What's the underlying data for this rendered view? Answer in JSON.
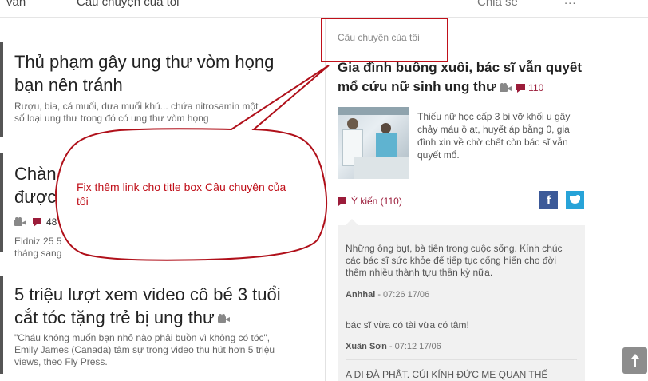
{
  "topnav": {
    "left_text": "văn",
    "tab_label": "Câu chuyện của tôi",
    "right_text": "Chia sẻ",
    "more_text": "..."
  },
  "articles": [
    {
      "title": "Thủ phạm gây ung thư vòm họng bạn nên tránh",
      "desc": "Rượu, bia, cá muối, dưa muối khú... chứa nitrosamin một số loại ung thư trong đó có ung thư vòm họng"
    },
    {
      "title": "Chàn được",
      "comment_count": "48",
      "byline": "Eldniz 25 5 tháng sang"
    },
    {
      "title": "5 triệu lượt xem video cô bé 3 tuổi cắt tóc tặng trẻ bị ung thư",
      "desc": "\"Cháu không muốn bạn nhỏ nào phải buồn vì không có tóc\", Emily James (Canada) tâm sự trong video thu hút hơn 5 triệu views, theo Fly Press."
    }
  ],
  "sidebar": {
    "box_title": "Câu chuyện của tôi",
    "main_title": "Gia đình buông xuôi, bác sĩ vẫn quyết mổ cứu nữ sinh ung thư",
    "main_comment_count": "110",
    "summary": "Thiếu nữ học cấp 3 bị vỡ khối u gây chảy máu ồ ạt, huyết áp bằng 0, gia đình xin về chờ chết còn bác sĩ vẫn quyết mổ.",
    "opinion_label": "Ý kiến (110)",
    "facebook_letter": "f",
    "comments": [
      {
        "text": "Những ông bụt, bà tiên trong cuộc sống. Kính chúc các bác sĩ sức khỏe để tiếp tục cống hiến cho đời thêm nhiều thành tựu thần kỳ nữa.",
        "author": "Anhhai",
        "time": " - 07:26 17/06"
      },
      {
        "text": "bác sĩ vừa có tài vừa có tâm!",
        "author": "Xuân Sơn",
        "time": " - 07:12 17/06"
      },
      {
        "text": "A DI ĐÀ PHẬT. CÚI KÍNH ĐỨC MẸ QUAN THẾ",
        "author": "",
        "time": ""
      }
    ]
  },
  "annotation": {
    "text": "Fix thêm link cho title box Câu chuyện của tôi"
  },
  "colors": {
    "accent": "#9b1c3a",
    "annotation": "#c0101a",
    "facebook": "#3b5998",
    "twitter": "#27a3d8"
  },
  "icons": {
    "video": "camera-icon",
    "comment": "comment-icon",
    "facebook": "facebook-icon",
    "twitter": "twitter-icon",
    "scroll_top": "arrow-up-icon"
  }
}
